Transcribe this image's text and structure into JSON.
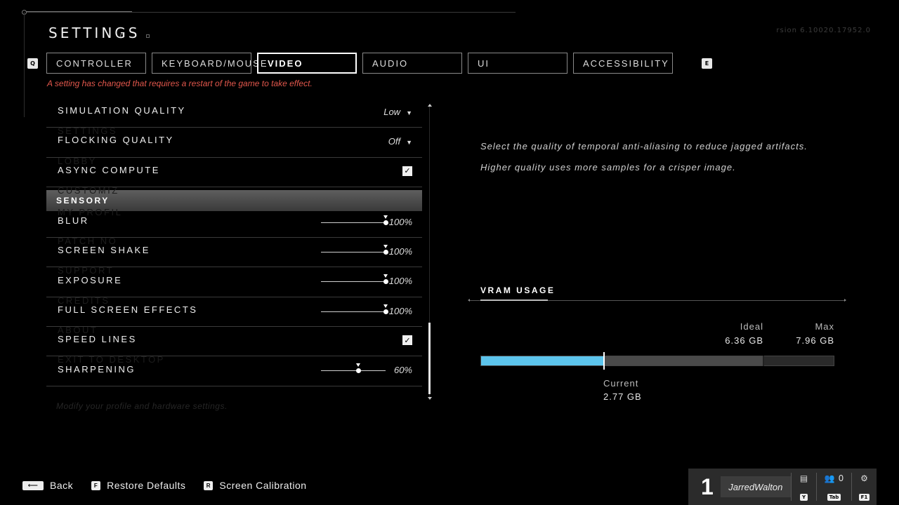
{
  "header": {
    "title": "SETTINGS",
    "ghost_title": "",
    "version": "rsion 6.10020.17952.0",
    "prev_tab_key": "Q",
    "next_tab_key": "E"
  },
  "tabs": [
    {
      "label": "CONTROLLER",
      "active": false
    },
    {
      "label": "KEYBOARD/MOUSE",
      "active": false
    },
    {
      "label": "VIDEO",
      "active": true
    },
    {
      "label": "AUDIO",
      "active": false
    },
    {
      "label": "UI",
      "active": false
    },
    {
      "label": "ACCESSIBILITY",
      "active": false
    }
  ],
  "warning": "A setting has changed that requires a restart of the game to take effect.",
  "settings": {
    "simulation_quality": {
      "label": "SIMULATION QUALITY",
      "value": "Low",
      "ghost": "SETTINGS"
    },
    "flocking_quality": {
      "label": "FLOCKING QUALITY",
      "value": "Off",
      "ghost": "LOBBY"
    },
    "async_compute": {
      "label": "ASYNC COMPUTE",
      "checked": true,
      "ghost": "CUSTOMIZ"
    },
    "section": "SENSORY",
    "blur": {
      "label": "BLUR",
      "value": "100%",
      "percent": 100,
      "ghost": "PATCH NO"
    },
    "screen_shake": {
      "label": "SCREEN SHAKE",
      "value": "100%",
      "percent": 100,
      "ghost": "SUPPORT"
    },
    "exposure": {
      "label": "EXPOSURE",
      "value": "100%",
      "percent": 100,
      "ghost": "CREDITS"
    },
    "full_screen_effects": {
      "label": "FULL SCREEN EFFECTS",
      "value": "100%",
      "percent": 100,
      "ghost": "ABOUT"
    },
    "speed_lines": {
      "label": "SPEED LINES",
      "checked": true,
      "ghost": "EXIT TO DESKTOP"
    },
    "sharpening": {
      "label": "SHARPENING",
      "value": "60%",
      "percent": 60
    },
    "section_ghost": "MY PROFIL",
    "footer_ghost": "Modify your profile and hardware settings."
  },
  "description": {
    "line1": "Select the quality of temporal anti-aliasing to reduce jagged artifacts.",
    "line2": "Higher quality uses more samples for a crisper image."
  },
  "vram": {
    "title": "VRAM USAGE",
    "ideal_label": "Ideal",
    "ideal_value": "6.36 GB",
    "max_label": "Max",
    "max_value": "7.96 GB",
    "current_label": "Current",
    "current_value": "2.77 GB",
    "current_gb": 2.77,
    "ideal_gb": 6.36,
    "max_gb": 7.96,
    "bar_color": "#5cc4ec"
  },
  "footer": {
    "back_label": "Back",
    "restore_key": "F",
    "restore_label": "Restore Defaults",
    "calibration_key": "R",
    "calibration_label": "Screen Calibration"
  },
  "profile": {
    "rank": "1",
    "name": "JarredWalton",
    "chat_key": "Y",
    "friends_count": "0",
    "friends_key": "Tab",
    "settings_key": "F1"
  }
}
